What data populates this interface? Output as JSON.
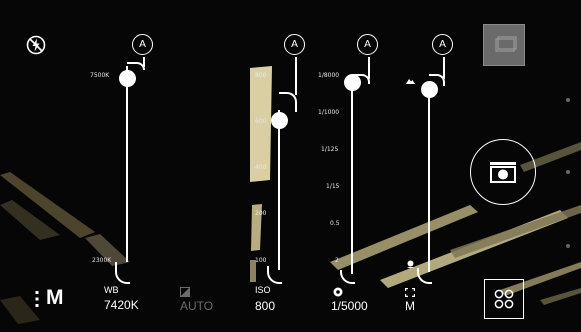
{
  "flash": {
    "icon": "flash-off-icon"
  },
  "mode": {
    "label": "M",
    "menu_icon": "more-vertical-icon"
  },
  "sliders": {
    "wb": {
      "auto_label": "A",
      "tick_top": "7500K",
      "tick_bottom": "2300K",
      "label": "WB",
      "value": "7420K"
    },
    "exposure": {
      "icon": "exposure-icon",
      "value": "AUTO"
    },
    "iso": {
      "auto_label": "A",
      "ticks": [
        "800",
        "600",
        "400",
        "200",
        "100"
      ],
      "label": "ISO",
      "value": "800"
    },
    "shutter": {
      "auto_label": "A",
      "ticks": [
        "1/8000",
        "1/1000",
        "1/125",
        "1/15",
        "0.5",
        "2"
      ],
      "icon": "aperture-icon",
      "value": "1/5000"
    },
    "focus": {
      "auto_label": "A",
      "top_icon": "mountain-icon",
      "bottom_icon": "flower-icon",
      "label_icon": "focus-frame-icon",
      "value": "M"
    }
  },
  "right_panel": {
    "gallery_icon": "gallery-thumbnail-icon",
    "shutter_icon": "camera-icon",
    "modes_icon": "grid-modes-icon"
  },
  "colors": {
    "foreground": "#ffffff",
    "disabled": "#6b6b6b",
    "thumbnail": "#6a6a6a"
  }
}
